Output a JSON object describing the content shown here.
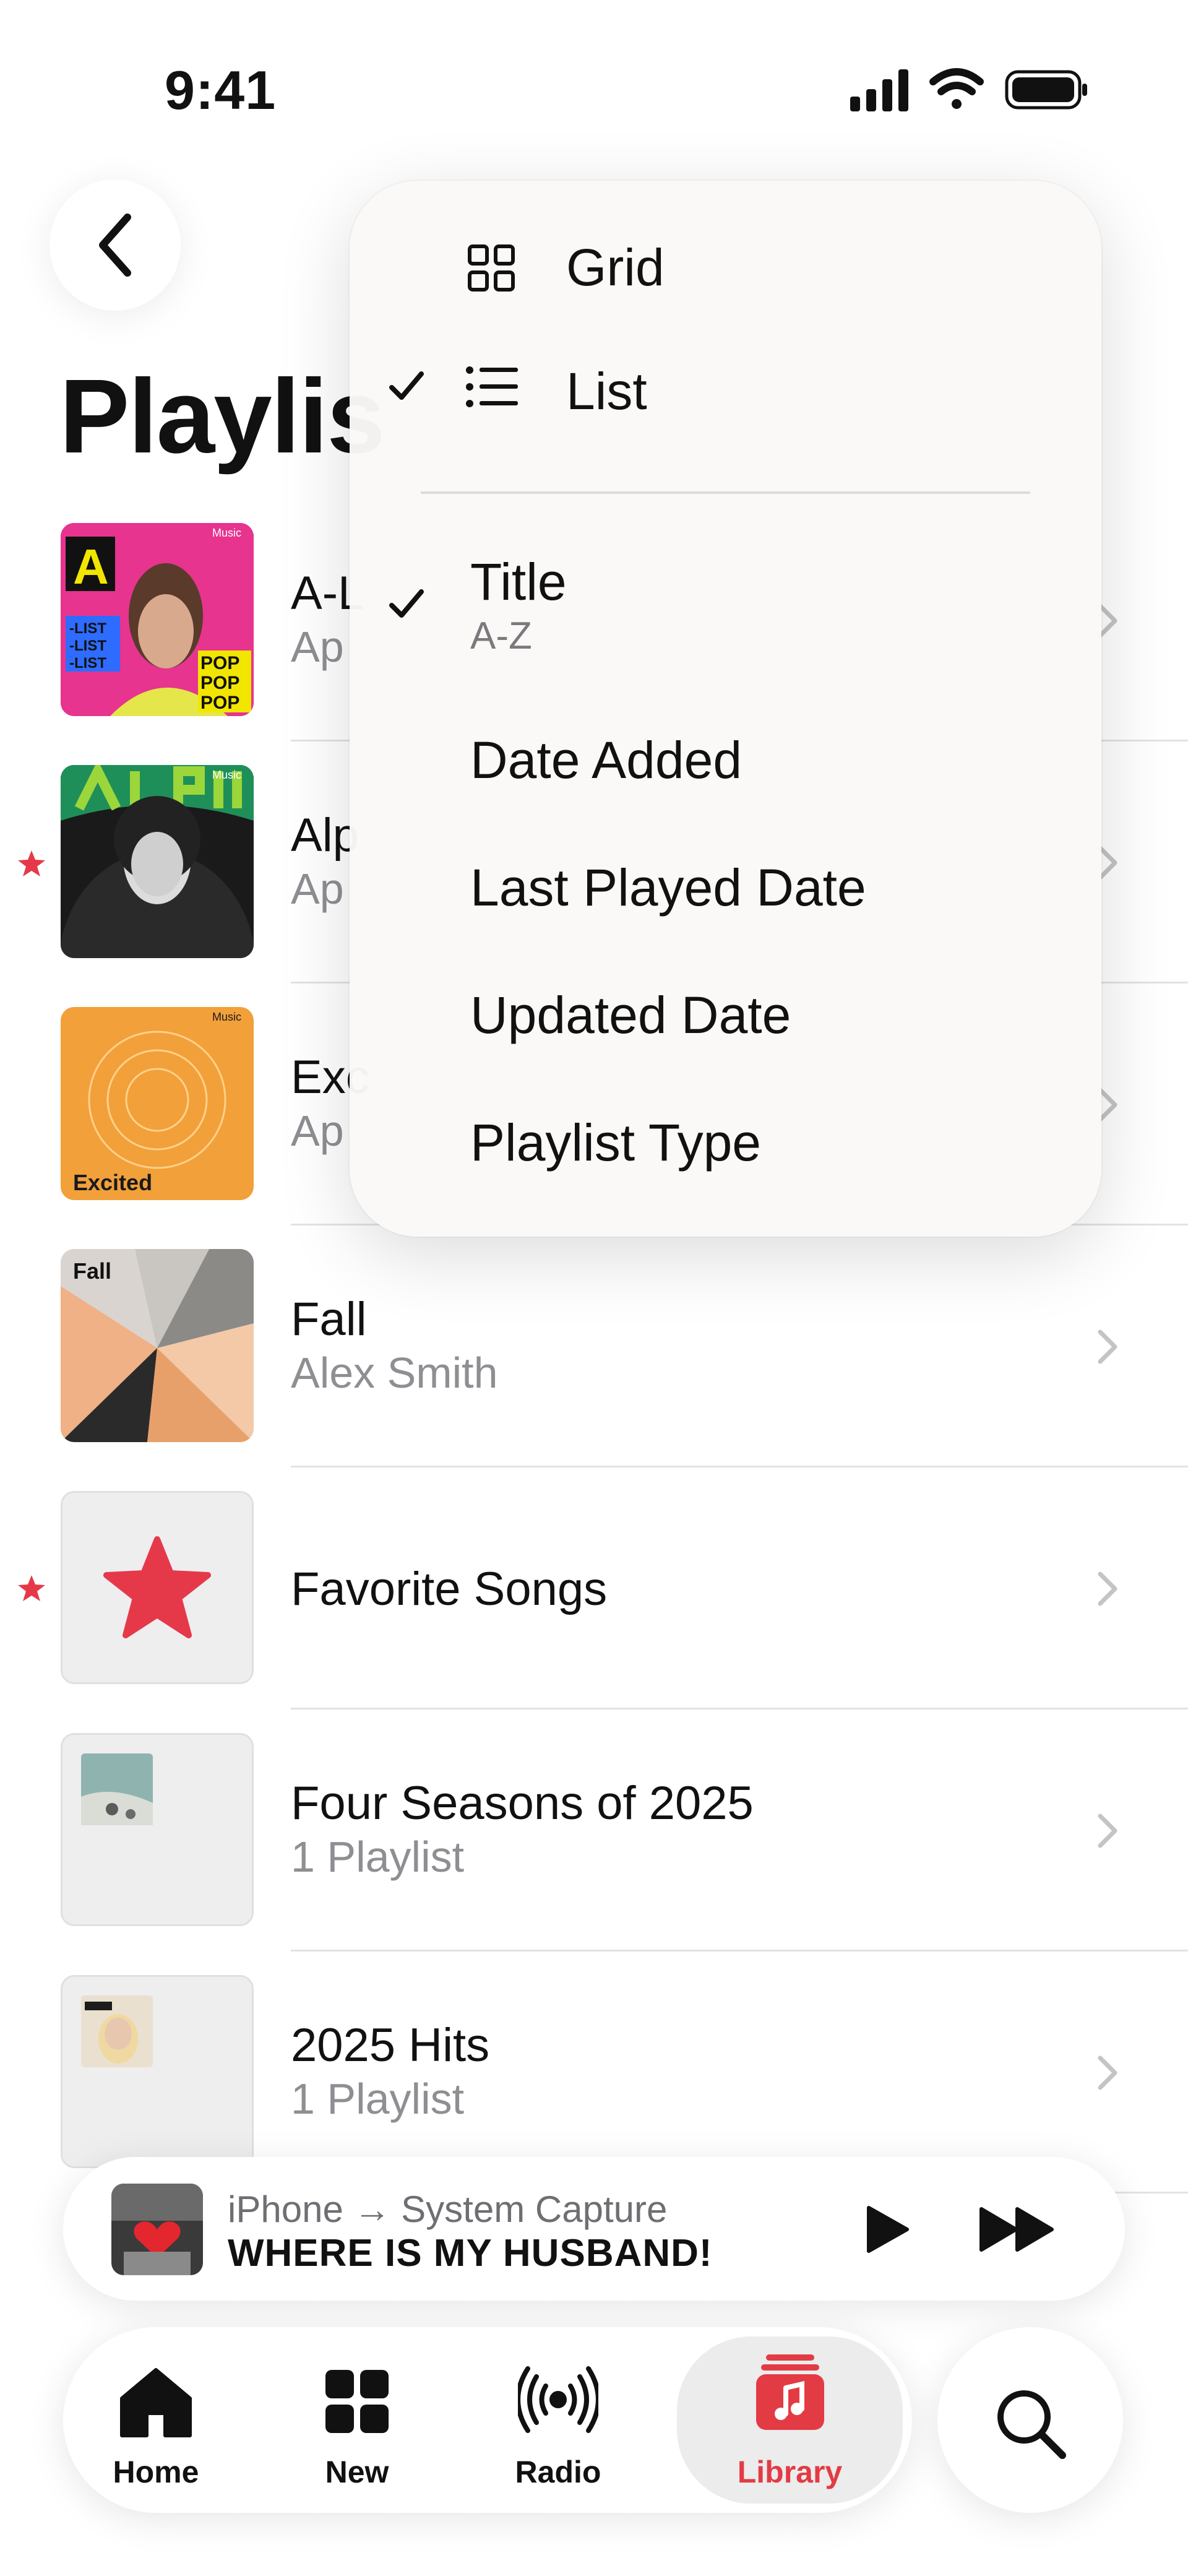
{
  "status_bar": {
    "time": "9:41"
  },
  "page": {
    "title": "Playlis"
  },
  "playlists": [
    {
      "title": "A-L",
      "subtitle": "Ap",
      "favorite": false,
      "art_text": [
        "-LIST",
        "-LIST",
        "-LIST"
      ],
      "art_text2": [
        "POP",
        "POP",
        "POP"
      ],
      "art_badge": "Music"
    },
    {
      "title": "Alp",
      "subtitle": "Ap",
      "favorite": true,
      "art_badge": "Music"
    },
    {
      "title": "Exc",
      "subtitle": "Ap",
      "favorite": false,
      "art_label": "Excited",
      "art_badge": "Music"
    },
    {
      "title": "Fall",
      "subtitle": "Alex Smith",
      "favorite": false,
      "art_label": "Fall"
    },
    {
      "title": "Favorite Songs",
      "subtitle": "",
      "favorite": true
    },
    {
      "title": "Four Seasons of 2025",
      "subtitle": "1 Playlist",
      "favorite": false
    },
    {
      "title": "2025 Hits",
      "subtitle": "1 Playlist",
      "favorite": false
    }
  ],
  "menu": {
    "view_options": [
      {
        "label": "Grid",
        "icon": "grid-icon",
        "checked": false
      },
      {
        "label": "List",
        "icon": "list-icon",
        "checked": true
      }
    ],
    "sort_options": [
      {
        "label": "Title",
        "sublabel": "A-Z",
        "checked": true
      },
      {
        "label": "Date Added",
        "checked": false
      },
      {
        "label": "Last Played Date",
        "checked": false
      },
      {
        "label": "Updated Date",
        "checked": false
      },
      {
        "label": "Playlist Type",
        "checked": false
      }
    ]
  },
  "mini_player": {
    "source": "iPhone → System Capture",
    "song": "WHERE IS MY HUSBAND!"
  },
  "tabs": [
    {
      "label": "Home",
      "icon": "home-icon",
      "active": false
    },
    {
      "label": "New",
      "icon": "new-grid-icon",
      "active": false
    },
    {
      "label": "Radio",
      "icon": "radio-icon",
      "active": false
    },
    {
      "label": "Library",
      "icon": "library-icon",
      "active": true
    }
  ],
  "colors": {
    "accent": "#e33b44",
    "star": "#e5394a",
    "text": "#111111",
    "secondary": "#8e8e93"
  }
}
